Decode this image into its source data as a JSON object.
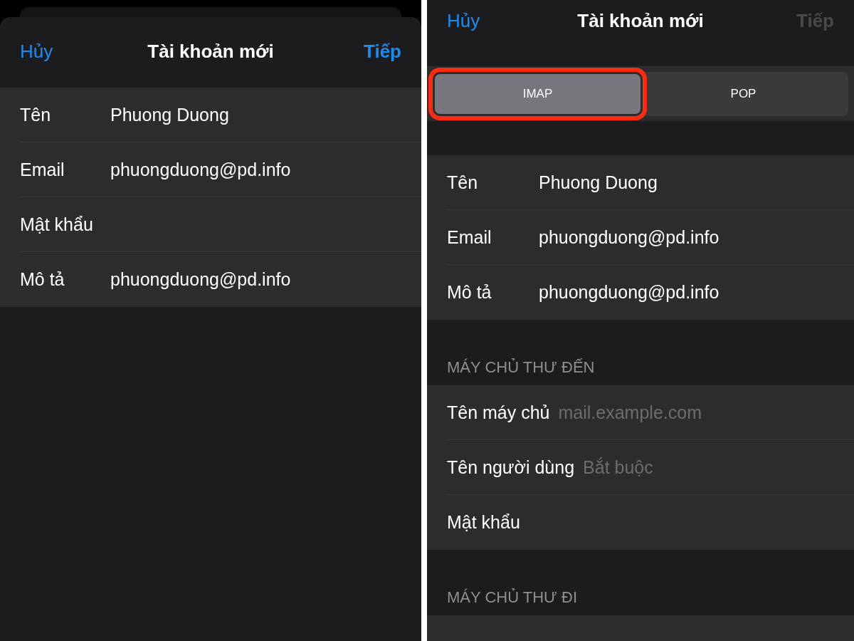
{
  "left_screen": {
    "nav": {
      "cancel": "Hủy",
      "title": "Tài khoản mới",
      "next": {
        "label": "Tiếp",
        "disabled": false
      }
    },
    "fields": [
      {
        "label": "Tên",
        "value": "Phuong Duong"
      },
      {
        "label": "Email",
        "value": "phuongduong@pd.info"
      },
      {
        "label": "Mật khẩu"
      },
      {
        "label": "Mô tả",
        "value": "phuongduong@pd.info"
      }
    ]
  },
  "right_screen": {
    "nav": {
      "cancel": "Hủy",
      "title": "Tài khoản mới",
      "next": {
        "label": "Tiếp",
        "disabled": true
      }
    },
    "segments": [
      {
        "label": "IMAP",
        "selected": true,
        "highlighted": true
      },
      {
        "label": "POP",
        "selected": false,
        "highlighted": false
      }
    ],
    "sections": [
      {
        "fields": [
          {
            "label": "Tên",
            "value": "Phuong Duong"
          },
          {
            "label": "Email",
            "value": "phuongduong@pd.info"
          },
          {
            "label": "Mô tả",
            "value": "phuongduong@pd.info"
          }
        ]
      },
      {
        "header": "MÁY CHỦ THƯ ĐẾN",
        "fields": [
          {
            "label": "Tên máy chủ",
            "placeholder": "mail.example.com"
          },
          {
            "label": "Tên người dùng",
            "placeholder": "Bắt buộc"
          },
          {
            "label": "Mật khẩu"
          }
        ]
      },
      {
        "header": "MÁY CHỦ THƯ ĐI"
      }
    ]
  }
}
